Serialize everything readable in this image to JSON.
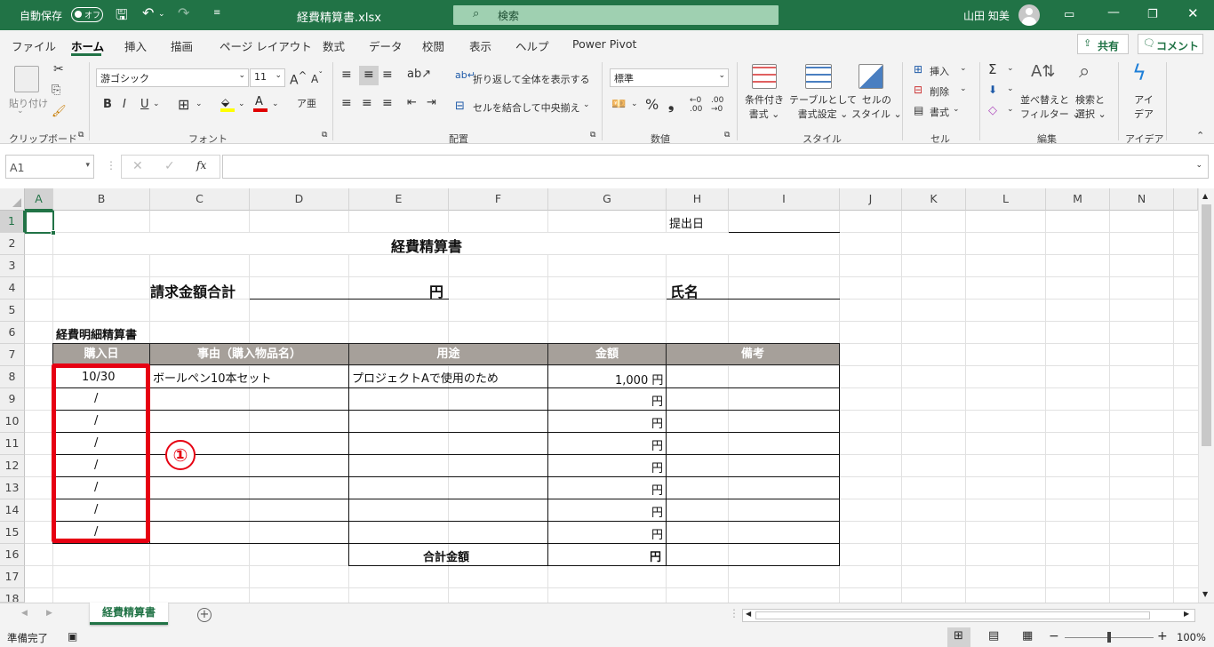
{
  "titlebar": {
    "autosave_label": "自動保存",
    "autosave_state": "オフ",
    "filename": "経費精算書.xlsx",
    "search_placeholder": "検索",
    "user_name": "山田 知美"
  },
  "menu": {
    "tabs": [
      "ファイル",
      "ホーム",
      "挿入",
      "描画",
      "ページ レイアウト",
      "数式",
      "データ",
      "校閲",
      "表示",
      "ヘルプ",
      "Power Pivot"
    ],
    "active_tab": "ホーム",
    "share_label": "共有",
    "comment_label": "コメント"
  },
  "ribbon": {
    "clipboard": {
      "paste": "貼り付け",
      "group": "クリップボード"
    },
    "font": {
      "name": "游ゴシック",
      "size": "11",
      "group": "フォント"
    },
    "alignment": {
      "wrap": "折り返して全体を表示する",
      "merge": "セルを結合して中央揃え",
      "group": "配置"
    },
    "number": {
      "format": "標準",
      "group": "数値"
    },
    "styles": {
      "conditional": [
        "条件付き",
        "書式"
      ],
      "table": [
        "テーブルとして",
        "書式設定"
      ],
      "cell": [
        "セルの",
        "スタイル"
      ],
      "group": "スタイル"
    },
    "cells": {
      "insert": "挿入",
      "delete": "削除",
      "format": "書式",
      "group": "セル"
    },
    "editing": {
      "sort": [
        "並べ替えと",
        "フィルター"
      ],
      "find": [
        "検索と",
        "選択"
      ],
      "group": "編集"
    },
    "ideas": {
      "label": [
        "アイ",
        "デア"
      ],
      "group": "アイデア"
    }
  },
  "formula_bar": {
    "name_box": "A1",
    "fx": "fx",
    "value": ""
  },
  "sheet": {
    "columns": [
      "A",
      "B",
      "C",
      "D",
      "E",
      "F",
      "G",
      "H",
      "I",
      "J",
      "K",
      "L",
      "M",
      "N"
    ],
    "rows": [
      "1",
      "2",
      "3",
      "4",
      "5",
      "6",
      "7",
      "8",
      "9",
      "10",
      "11",
      "12",
      "13",
      "14",
      "15",
      "16",
      "17",
      "18"
    ],
    "submit_date_label": "提出日",
    "title": "経費精算書",
    "total_claim_label": "請求金額合計",
    "yen": "円",
    "name_label": "氏名",
    "detail_title": "経費明細精算書",
    "table_headers": [
      "購入日",
      "事由（購入物品名）",
      "用途",
      "金額",
      "備考"
    ],
    "row8": {
      "date": "10/30",
      "item": "ボールペン10本セット",
      "purpose": "プロジェクトAで使用のため",
      "amount": "1,000 円"
    },
    "date_placeholder": "/",
    "total_amount_label": "合計金額",
    "annotation": "①"
  },
  "sheet_tabs": {
    "active": "経費精算書"
  },
  "status": {
    "ready": "準備完了",
    "zoom": "100%"
  },
  "colors": {
    "accent": "#217346",
    "highlight": "#e60012",
    "table_header": "#a6a09a"
  }
}
